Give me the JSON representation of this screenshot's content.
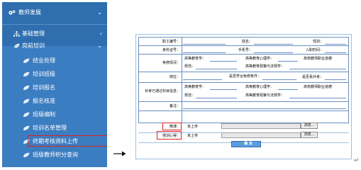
{
  "sidebar": {
    "top": {
      "label": "教师发展",
      "chevron": "⌄"
    },
    "base_mgmt": {
      "label": "基础管理",
      "chevron": "‹"
    },
    "pre_train": {
      "label": "岗前培训",
      "chevron": "⌄"
    },
    "items": [
      {
        "label": "结业处理"
      },
      {
        "label": "培训班级"
      },
      {
        "label": "培训报名"
      },
      {
        "label": "报名核准"
      },
      {
        "label": "班级编制"
      },
      {
        "label": "培训名单管理"
      },
      {
        "label": "终期考核资料上传"
      },
      {
        "label": "班级教师积分查询"
      }
    ]
  },
  "form": {
    "row1": {
      "a": "职工编号：",
      "b": "姓名：",
      "c": "性别："
    },
    "row2": {
      "a": "身份证号：",
      "b": "手机号：",
      "c": "入职时间："
    },
    "row3": {
      "a": "免修情况：",
      "opt1": "高等教育学：",
      "opt2": "高等教育心理学：",
      "opt3": "高校教师职业道德",
      "opt4": "规范：",
      "opt5": "高等教育政策与法规学："
    },
    "row4": {
      "a": "岗位：",
      "b": "是否符合免修条件：",
      "c": "是否系外考："
    },
    "row5": {
      "a": "补考已通过科目信息：",
      "opt1": "高等教育学：",
      "opt2": "高等教育心理学：",
      "opt3": "高校教师职业道德",
      "opt4": "规范：",
      "opt5": "高等教育政策与法规学："
    },
    "row6": {
      "a": "备注："
    },
    "upload1": {
      "label": "微课：",
      "status": "未上传",
      "browse": "浏览..."
    },
    "upload2": {
      "label": "培训心得：",
      "status": "未上传",
      "browse": "浏览..."
    },
    "confirm": "确 定"
  },
  "enter_mark": "↵"
}
